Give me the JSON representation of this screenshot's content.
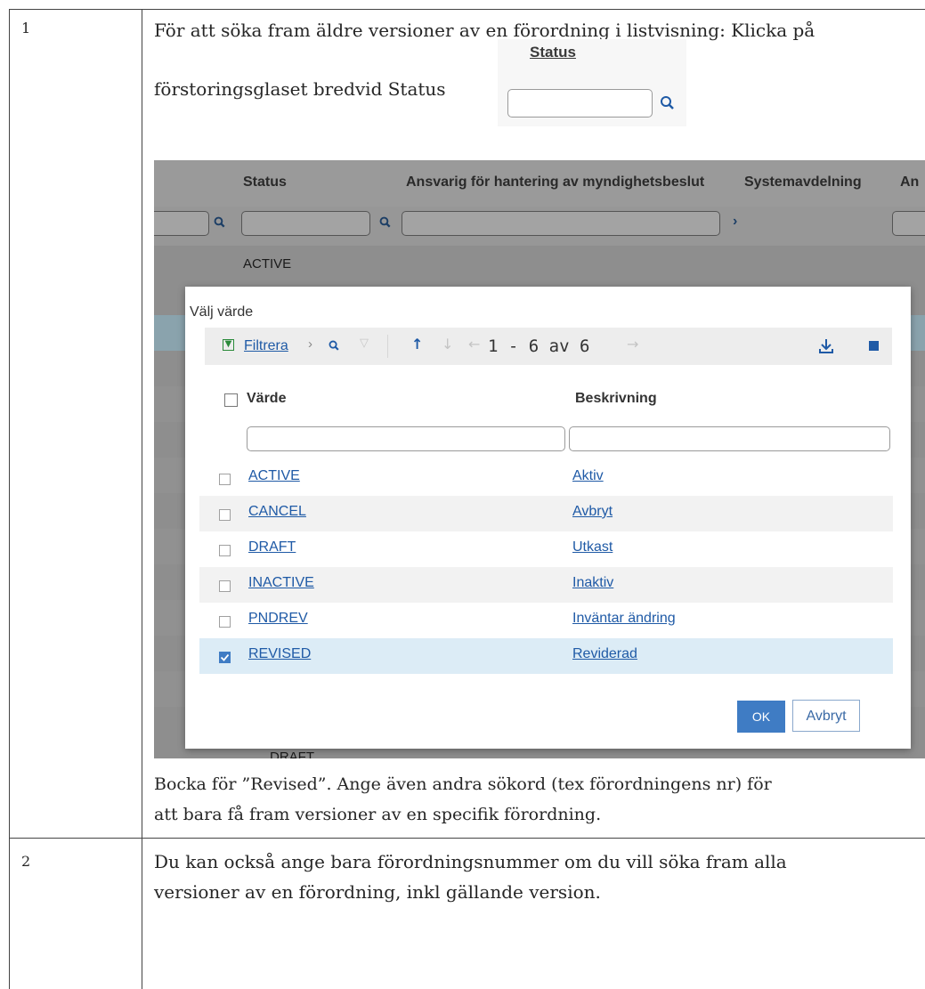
{
  "table": {
    "row1_num": "1",
    "row1_intro_line1": "För att söka fram äldre versioner av en förordning i listvisning: Klicka på",
    "row1_intro_line2": "förstoringsglaset bredvid Status",
    "row1_outro_line1": "Bocka för ”Revised”. Ange även andra sökord (tex förordningens nr)  för",
    "row1_outro_line2": "att bara få fram versioner av en specifik förordning.",
    "row2_num": "2",
    "row2_text_line1": "Du kan också ange bara förordningsnummer om du vill söka fram alla",
    "row2_text_line2": "versioner av en förordning, inkl gällande version."
  },
  "snippet": {
    "status_label": "Status"
  },
  "bg": {
    "col_status": "Status",
    "col_ansvarig": "Ansvarig för hantering av myndighetsbeslut",
    "col_systemavdelning": "Systemavdelning",
    "col_cut": "An",
    "first_row_status": "ACTIVE",
    "bottom_row_status": "DRAFT"
  },
  "dialog": {
    "title": "Välj värde",
    "toolbar": {
      "filter_label": "Filtrera",
      "pager": "1 - 6 av 6"
    },
    "col_value": "Värde",
    "col_description": "Beskrivning",
    "rows": [
      {
        "value": "ACTIVE",
        "description": "Aktiv",
        "checked": false
      },
      {
        "value": "CANCEL",
        "description": "Avbryt",
        "checked": false
      },
      {
        "value": "DRAFT",
        "description": "Utkast",
        "checked": false
      },
      {
        "value": "INACTIVE",
        "description": "Inaktiv",
        "checked": false
      },
      {
        "value": "PNDREV",
        "description": "Inväntar ändring",
        "checked": false
      },
      {
        "value": "REVISED",
        "description": "Reviderad",
        "checked": true
      }
    ],
    "ok_label": "OK",
    "cancel_label": "Avbryt"
  },
  "colors": {
    "link": "#1f5aa6",
    "ok_button": "#3f7cc4",
    "selected_row": "#dcecf6",
    "overlay_bg": "#8e8e8e"
  }
}
